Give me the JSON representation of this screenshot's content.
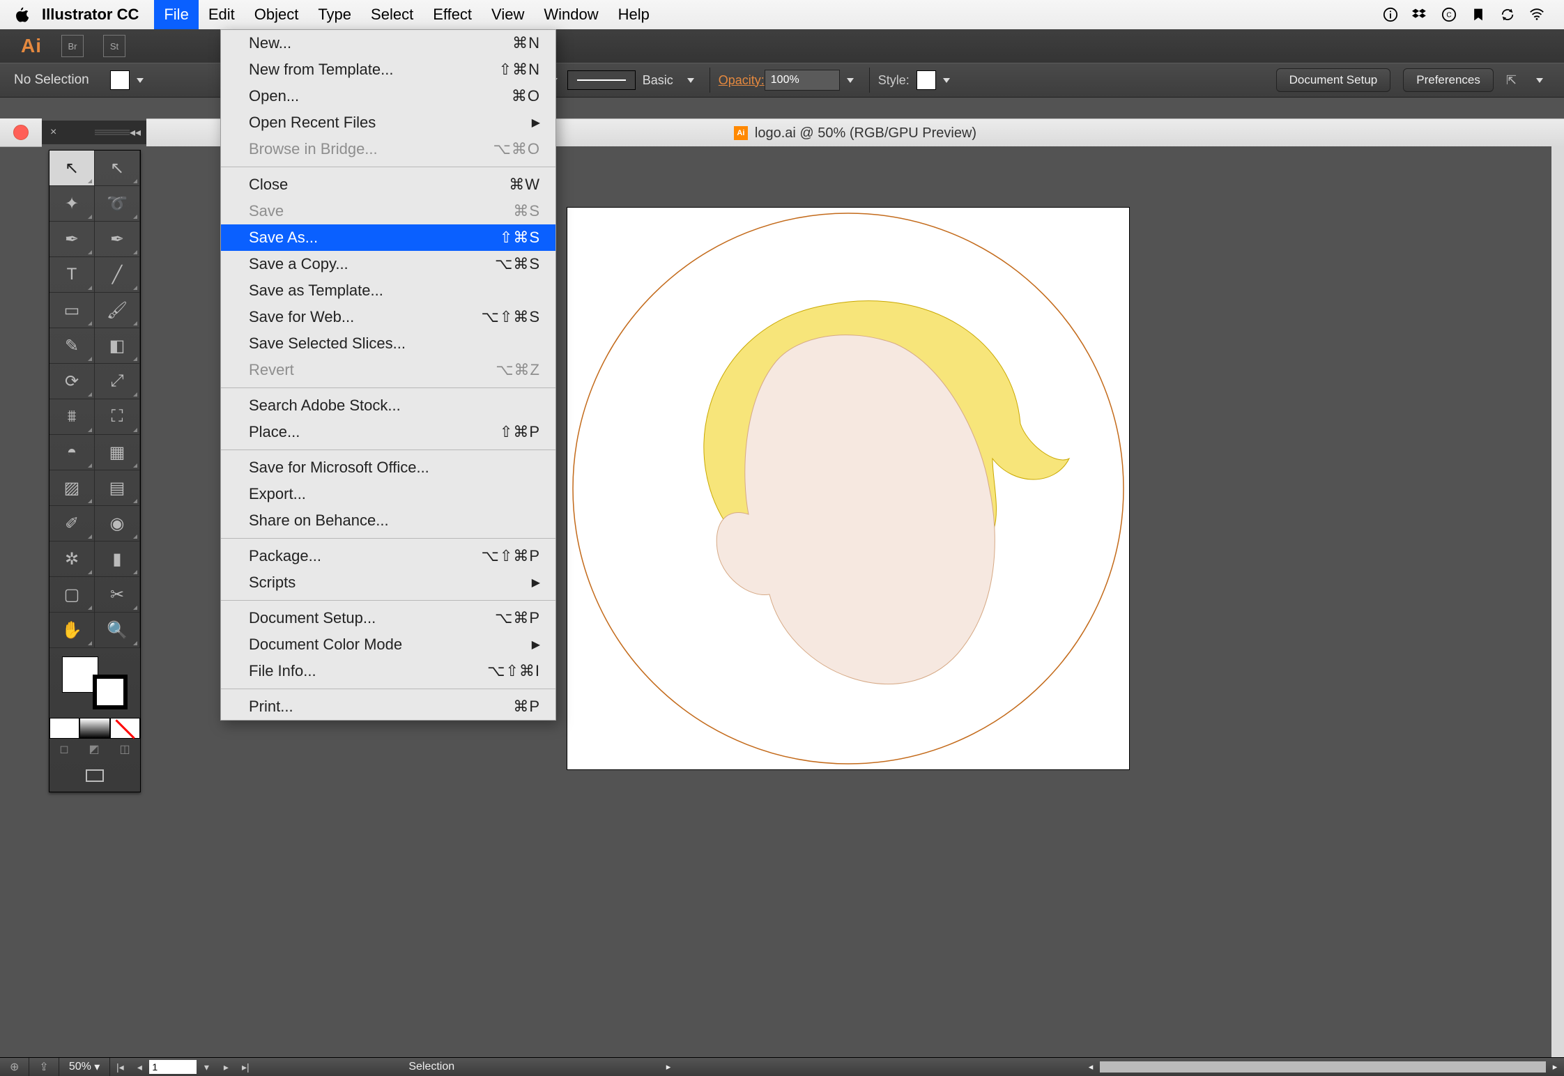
{
  "mac_menu": {
    "app_name": "Illustrator CC",
    "items": [
      "File",
      "Edit",
      "Object",
      "Type",
      "Select",
      "Effect",
      "View",
      "Window",
      "Help"
    ],
    "active_index": 0
  },
  "mac_right_icons": [
    "info-icon",
    "dropbox-icon",
    "cc-icon",
    "bookmark-icon",
    "sync-icon",
    "wifi-icon"
  ],
  "app_top": {
    "logo": "Ai",
    "mini1": "Br",
    "mini2": "St"
  },
  "control_bar": {
    "selection": "No Selection",
    "iform": "iform",
    "brush_label": "Basic",
    "opacity_label": "Opacity:",
    "opacity_value": "100%",
    "style_label": "Style:",
    "doc_setup": "Document Setup",
    "prefs": "Preferences"
  },
  "doc_tab": {
    "title": "logo.ai @ 50% (RGB/GPU Preview)"
  },
  "tool_panel": {
    "tools": [
      {
        "name": "selection-tool",
        "glyph": "↖",
        "sel": true
      },
      {
        "name": "direct-selection-tool",
        "glyph": "↖"
      },
      {
        "name": "magic-wand-tool",
        "glyph": "✦"
      },
      {
        "name": "lasso-tool",
        "glyph": "➰"
      },
      {
        "name": "pen-tool",
        "glyph": "✒"
      },
      {
        "name": "curvature-tool",
        "glyph": "✒"
      },
      {
        "name": "type-tool",
        "glyph": "T"
      },
      {
        "name": "line-tool",
        "glyph": "╱"
      },
      {
        "name": "rectangle-tool",
        "glyph": "▭"
      },
      {
        "name": "paintbrush-tool",
        "glyph": "🖌"
      },
      {
        "name": "pencil-tool",
        "glyph": "✎"
      },
      {
        "name": "eraser-tool",
        "glyph": "◧"
      },
      {
        "name": "rotate-tool",
        "glyph": "⟳"
      },
      {
        "name": "scale-tool",
        "glyph": "⤢"
      },
      {
        "name": "width-tool",
        "glyph": "⩩"
      },
      {
        "name": "free-transform-tool",
        "glyph": "⛶"
      },
      {
        "name": "shape-builder-tool",
        "glyph": "◓"
      },
      {
        "name": "perspective-tool",
        "glyph": "▦"
      },
      {
        "name": "mesh-tool",
        "glyph": "▨"
      },
      {
        "name": "gradient-tool",
        "glyph": "▤"
      },
      {
        "name": "eyedropper-tool",
        "glyph": "✐"
      },
      {
        "name": "blend-tool",
        "glyph": "◉"
      },
      {
        "name": "symbol-sprayer-tool",
        "glyph": "✲"
      },
      {
        "name": "graph-tool",
        "glyph": "▮"
      },
      {
        "name": "artboard-tool",
        "glyph": "▢"
      },
      {
        "name": "slice-tool",
        "glyph": "✂"
      },
      {
        "name": "hand-tool",
        "glyph": "✋"
      },
      {
        "name": "zoom-tool",
        "glyph": "🔍"
      }
    ]
  },
  "dropdown": {
    "groups": [
      [
        {
          "label": "New...",
          "sc": "⌘N"
        },
        {
          "label": "New from Template...",
          "sc": "⇧⌘N"
        },
        {
          "label": "Open...",
          "sc": "⌘O"
        },
        {
          "label": "Open Recent Files",
          "arrow": true
        },
        {
          "label": "Browse in Bridge...",
          "sc": "⌥⌘O",
          "dim": true
        }
      ],
      [
        {
          "label": "Close",
          "sc": "⌘W"
        },
        {
          "label": "Save",
          "sc": "⌘S",
          "dim": true
        },
        {
          "label": "Save As...",
          "sc": "⇧⌘S",
          "hl": true
        },
        {
          "label": "Save a Copy...",
          "sc": "⌥⌘S"
        },
        {
          "label": "Save as Template..."
        },
        {
          "label": "Save for Web...",
          "sc": "⌥⇧⌘S"
        },
        {
          "label": "Save Selected Slices..."
        },
        {
          "label": "Revert",
          "sc": "⌥⌘Z",
          "dim": true
        }
      ],
      [
        {
          "label": "Search Adobe Stock..."
        },
        {
          "label": "Place...",
          "sc": "⇧⌘P"
        }
      ],
      [
        {
          "label": "Save for Microsoft Office..."
        },
        {
          "label": "Export..."
        },
        {
          "label": "Share on Behance..."
        }
      ],
      [
        {
          "label": "Package...",
          "sc": "⌥⇧⌘P"
        },
        {
          "label": "Scripts",
          "arrow": true
        }
      ],
      [
        {
          "label": "Document Setup...",
          "sc": "⌥⌘P"
        },
        {
          "label": "Document Color Mode",
          "arrow": true
        },
        {
          "label": "File Info...",
          "sc": "⌥⇧⌘I"
        }
      ],
      [
        {
          "label": "Print...",
          "sc": "⌘P"
        }
      ]
    ]
  },
  "status": {
    "zoom": "50%",
    "page": "1",
    "mode": "Selection"
  }
}
